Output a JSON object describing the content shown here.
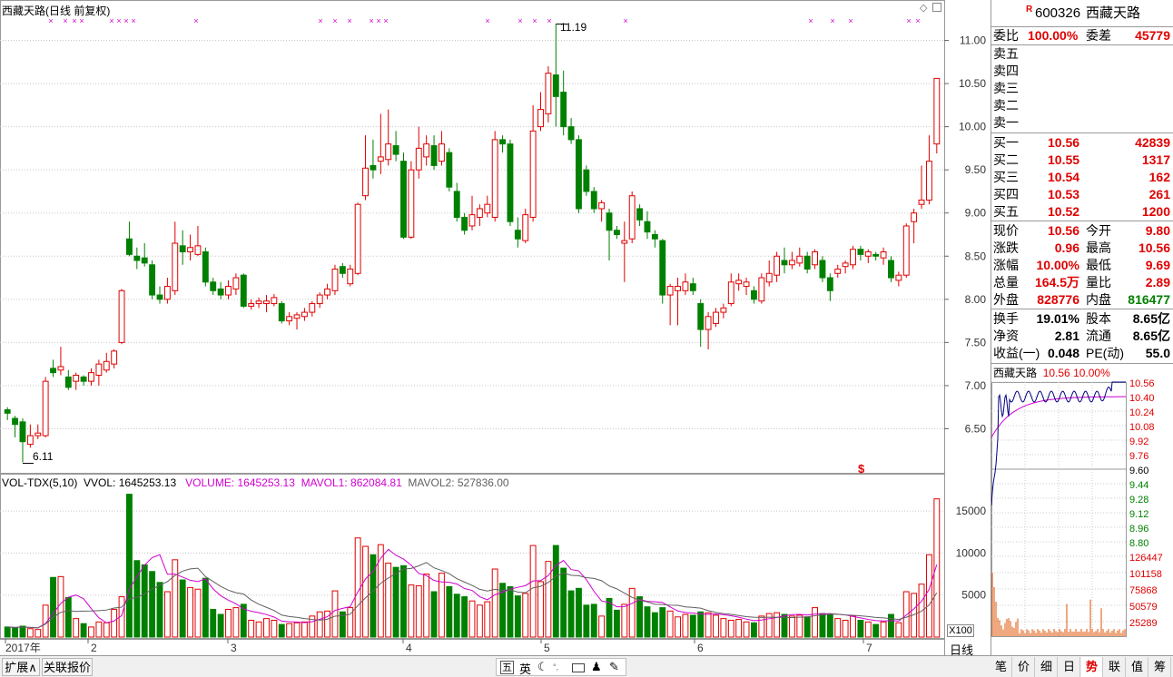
{
  "main_chart": {
    "title": "西藏天路(日线 前复权)",
    "high_marker": "11.19",
    "low_marker": "6.11",
    "signal_mark": "$",
    "price_ticks": [
      "11.00",
      "10.50",
      "10.00",
      "9.50",
      "9.00",
      "8.50",
      "8.00",
      "7.50",
      "7.00",
      "6.50"
    ],
    "date_labels": [
      "2017年",
      "2",
      "3",
      "4",
      "5",
      "6",
      "7"
    ],
    "colors": {
      "up": "#e00000",
      "down": "#008000",
      "grid": "#c8c8c8",
      "ma1": "#d000d0",
      "ma2": "#606060"
    }
  },
  "volume_panel": {
    "indicator": "VOL-TDX(5,10)",
    "vvol": "VVOL: 1645253.13",
    "volume": "VOLUME: 1645253.13",
    "mavol1": "MAVOL1: 862084.81",
    "mavol2": "MAVOL2: 527836.00",
    "ticks": [
      "15000",
      "10000",
      "5000"
    ],
    "unit_label": "X100",
    "period_label": "日线"
  },
  "chart_data": {
    "type": "candlestick",
    "title": "西藏天路(日线 前复权)",
    "ylim": [
      6.0,
      11.3
    ],
    "candles": [
      {
        "o": 6.72,
        "c": 6.68,
        "h": 6.75,
        "l": 6.6,
        "v": 1200
      },
      {
        "o": 6.62,
        "c": 6.55,
        "h": 6.65,
        "l": 6.4,
        "v": 1100
      },
      {
        "o": 6.58,
        "c": 6.35,
        "h": 6.62,
        "l": 6.11,
        "v": 1300
      },
      {
        "o": 6.32,
        "c": 6.42,
        "h": 6.55,
        "l": 6.28,
        "v": 1000
      },
      {
        "o": 6.42,
        "c": 6.45,
        "h": 6.55,
        "l": 6.38,
        "v": 900
      },
      {
        "o": 6.42,
        "c": 7.05,
        "h": 7.1,
        "l": 6.4,
        "v": 3800
      },
      {
        "o": 7.2,
        "c": 7.15,
        "h": 7.3,
        "l": 7.1,
        "v": 7100
      },
      {
        "o": 7.18,
        "c": 7.22,
        "h": 7.45,
        "l": 7.12,
        "v": 7200
      },
      {
        "o": 7.1,
        "c": 6.98,
        "h": 7.18,
        "l": 6.95,
        "v": 4700
      },
      {
        "o": 7.05,
        "c": 7.12,
        "h": 7.15,
        "l": 6.95,
        "v": 2200
      },
      {
        "o": 7.1,
        "c": 7.05,
        "h": 7.12,
        "l": 7.0,
        "v": 1600
      },
      {
        "o": 7.05,
        "c": 7.15,
        "h": 7.2,
        "l": 7.0,
        "v": 1200
      },
      {
        "o": 7.12,
        "c": 7.25,
        "h": 7.3,
        "l": 7.0,
        "v": 1800
      },
      {
        "o": 7.18,
        "c": 7.28,
        "h": 7.38,
        "l": 7.15,
        "v": 1700
      },
      {
        "o": 7.25,
        "c": 7.4,
        "h": 7.42,
        "l": 7.2,
        "v": 3300
      },
      {
        "o": 7.5,
        "c": 8.1,
        "h": 8.12,
        "l": 7.48,
        "v": 4800
      },
      {
        "o": 8.7,
        "c": 8.52,
        "h": 8.9,
        "l": 8.5,
        "v": 17000
      },
      {
        "o": 8.5,
        "c": 8.45,
        "h": 8.6,
        "l": 8.35,
        "v": 9100
      },
      {
        "o": 8.48,
        "c": 8.42,
        "h": 8.65,
        "l": 8.38,
        "v": 8600
      },
      {
        "o": 8.4,
        "c": 8.05,
        "h": 8.45,
        "l": 8.0,
        "v": 7800
      },
      {
        "o": 8.05,
        "c": 8.0,
        "h": 8.15,
        "l": 7.95,
        "v": 6500
      },
      {
        "o": 8.0,
        "c": 8.15,
        "h": 8.25,
        "l": 7.95,
        "v": 5400
      },
      {
        "o": 8.1,
        "c": 8.65,
        "h": 8.9,
        "l": 8.05,
        "v": 9200
      },
      {
        "o": 8.62,
        "c": 8.55,
        "h": 8.8,
        "l": 8.4,
        "v": 6800
      },
      {
        "o": 8.55,
        "c": 8.6,
        "h": 8.75,
        "l": 8.45,
        "v": 5900
      },
      {
        "o": 8.52,
        "c": 8.62,
        "h": 8.85,
        "l": 8.5,
        "v": 5700
      },
      {
        "o": 8.55,
        "c": 8.2,
        "h": 8.6,
        "l": 8.15,
        "v": 7000
      },
      {
        "o": 8.2,
        "c": 8.1,
        "h": 8.25,
        "l": 8.05,
        "v": 3300
      },
      {
        "o": 8.12,
        "c": 8.05,
        "h": 8.2,
        "l": 8.0,
        "v": 2700
      },
      {
        "o": 8.05,
        "c": 8.15,
        "h": 8.22,
        "l": 8.0,
        "v": 3300
      },
      {
        "o": 8.12,
        "c": 8.25,
        "h": 8.3,
        "l": 8.05,
        "v": 3500
      },
      {
        "o": 8.28,
        "c": 7.92,
        "h": 8.3,
        "l": 7.9,
        "v": 3900
      },
      {
        "o": 7.92,
        "c": 7.95,
        "h": 8.0,
        "l": 7.88,
        "v": 2000
      },
      {
        "o": 7.95,
        "c": 7.98,
        "h": 8.02,
        "l": 7.9,
        "v": 1800
      },
      {
        "o": 7.95,
        "c": 7.98,
        "h": 8.05,
        "l": 7.85,
        "v": 2200
      },
      {
        "o": 7.95,
        "c": 8.02,
        "h": 8.06,
        "l": 7.92,
        "v": 2000
      },
      {
        "o": 7.95,
        "c": 7.75,
        "h": 7.98,
        "l": 7.72,
        "v": 1500
      },
      {
        "o": 7.75,
        "c": 7.8,
        "h": 7.85,
        "l": 7.7,
        "v": 1600
      },
      {
        "o": 7.78,
        "c": 7.82,
        "h": 7.85,
        "l": 7.65,
        "v": 1700
      },
      {
        "o": 7.8,
        "c": 7.85,
        "h": 7.9,
        "l": 7.75,
        "v": 1800
      },
      {
        "o": 7.85,
        "c": 7.95,
        "h": 7.98,
        "l": 7.8,
        "v": 2500
      },
      {
        "o": 7.95,
        "c": 8.05,
        "h": 8.08,
        "l": 7.9,
        "v": 3000
      },
      {
        "o": 8.05,
        "c": 8.12,
        "h": 8.18,
        "l": 8.0,
        "v": 3100
      },
      {
        "o": 8.1,
        "c": 8.35,
        "h": 8.4,
        "l": 8.05,
        "v": 5500
      },
      {
        "o": 8.38,
        "c": 8.3,
        "h": 8.42,
        "l": 8.25,
        "v": 3000
      },
      {
        "o": 8.18,
        "c": 8.35,
        "h": 8.4,
        "l": 8.15,
        "v": 3500
      },
      {
        "o": 8.3,
        "c": 9.1,
        "h": 9.12,
        "l": 8.28,
        "v": 11800
      },
      {
        "o": 9.2,
        "c": 9.52,
        "h": 9.9,
        "l": 9.15,
        "v": 10800
      },
      {
        "o": 9.55,
        "c": 9.5,
        "h": 9.85,
        "l": 9.4,
        "v": 9800
      },
      {
        "o": 9.6,
        "c": 9.65,
        "h": 10.15,
        "l": 9.45,
        "v": 11000
      },
      {
        "o": 9.62,
        "c": 9.8,
        "h": 10.2,
        "l": 9.55,
        "v": 8800
      },
      {
        "o": 9.78,
        "c": 9.68,
        "h": 9.95,
        "l": 9.6,
        "v": 8300
      },
      {
        "o": 9.6,
        "c": 8.72,
        "h": 9.7,
        "l": 8.7,
        "v": 8500
      },
      {
        "o": 8.72,
        "c": 9.5,
        "h": 9.6,
        "l": 8.7,
        "v": 6200
      },
      {
        "o": 9.5,
        "c": 9.75,
        "h": 10.0,
        "l": 9.4,
        "v": 6100
      },
      {
        "o": 9.65,
        "c": 9.8,
        "h": 9.9,
        "l": 9.55,
        "v": 7500
      },
      {
        "o": 9.78,
        "c": 9.55,
        "h": 9.9,
        "l": 9.5,
        "v": 5400
      },
      {
        "o": 9.6,
        "c": 9.8,
        "h": 9.95,
        "l": 9.55,
        "v": 7600
      },
      {
        "o": 9.7,
        "c": 9.3,
        "h": 9.75,
        "l": 9.25,
        "v": 6000
      },
      {
        "o": 9.25,
        "c": 8.95,
        "h": 9.35,
        "l": 8.9,
        "v": 5100
      },
      {
        "o": 8.95,
        "c": 8.8,
        "h": 9.0,
        "l": 8.75,
        "v": 4800
      },
      {
        "o": 8.85,
        "c": 8.98,
        "h": 9.2,
        "l": 8.8,
        "v": 4300
      },
      {
        "o": 8.95,
        "c": 9.05,
        "h": 9.1,
        "l": 8.85,
        "v": 3800
      },
      {
        "o": 9.0,
        "c": 9.1,
        "h": 9.2,
        "l": 8.95,
        "v": 4200
      },
      {
        "o": 8.95,
        "c": 9.85,
        "h": 9.95,
        "l": 8.9,
        "v": 8100
      },
      {
        "o": 9.85,
        "c": 9.8,
        "h": 9.9,
        "l": 9.7,
        "v": 6400
      },
      {
        "o": 9.8,
        "c": 8.9,
        "h": 9.85,
        "l": 8.85,
        "v": 6000
      },
      {
        "o": 8.8,
        "c": 8.7,
        "h": 8.95,
        "l": 8.6,
        "v": 4900
      },
      {
        "o": 8.68,
        "c": 8.98,
        "h": 9.05,
        "l": 8.65,
        "v": 5200
      },
      {
        "o": 8.95,
        "c": 9.95,
        "h": 10.25,
        "l": 8.9,
        "v": 10900
      },
      {
        "o": 10.0,
        "c": 10.2,
        "h": 10.4,
        "l": 9.95,
        "v": 6600
      },
      {
        "o": 10.15,
        "c": 10.62,
        "h": 10.7,
        "l": 10.05,
        "v": 9000
      },
      {
        "o": 10.6,
        "c": 10.35,
        "h": 11.19,
        "l": 10.0,
        "v": 10900
      },
      {
        "o": 10.4,
        "c": 10.0,
        "h": 10.65,
        "l": 9.9,
        "v": 8200
      },
      {
        "o": 10.0,
        "c": 9.85,
        "h": 10.1,
        "l": 9.8,
        "v": 5500
      },
      {
        "o": 9.85,
        "c": 9.05,
        "h": 9.9,
        "l": 9.0,
        "v": 5800
      },
      {
        "o": 9.5,
        "c": 9.25,
        "h": 9.55,
        "l": 9.2,
        "v": 3800
      },
      {
        "o": 9.25,
        "c": 9.05,
        "h": 9.3,
        "l": 9.0,
        "v": 3900
      },
      {
        "o": 9.05,
        "c": 9.12,
        "h": 9.15,
        "l": 8.9,
        "v": 2500
      },
      {
        "o": 9.0,
        "c": 8.8,
        "h": 9.05,
        "l": 8.45,
        "v": 4600
      },
      {
        "o": 8.8,
        "c": 8.75,
        "h": 8.85,
        "l": 8.7,
        "v": 3200
      },
      {
        "o": 8.65,
        "c": 8.68,
        "h": 8.9,
        "l": 8.2,
        "v": 3900
      },
      {
        "o": 8.7,
        "c": 9.2,
        "h": 9.25,
        "l": 8.65,
        "v": 5800
      },
      {
        "o": 9.05,
        "c": 8.92,
        "h": 9.1,
        "l": 8.85,
        "v": 4800
      },
      {
        "o": 8.9,
        "c": 8.78,
        "h": 9.02,
        "l": 8.7,
        "v": 3600
      },
      {
        "o": 8.75,
        "c": 8.7,
        "h": 8.8,
        "l": 8.6,
        "v": 2900
      },
      {
        "o": 8.68,
        "c": 8.05,
        "h": 8.7,
        "l": 7.95,
        "v": 3500
      },
      {
        "o": 8.05,
        "c": 8.15,
        "h": 8.18,
        "l": 7.7,
        "v": 3100
      },
      {
        "o": 8.1,
        "c": 8.15,
        "h": 8.25,
        "l": 7.7,
        "v": 2400
      },
      {
        "o": 8.1,
        "c": 8.2,
        "h": 8.3,
        "l": 8.05,
        "v": 2700
      },
      {
        "o": 8.18,
        "c": 8.1,
        "h": 8.25,
        "l": 8.05,
        "v": 2600
      },
      {
        "o": 7.95,
        "c": 7.65,
        "h": 8.0,
        "l": 7.45,
        "v": 3000
      },
      {
        "o": 7.65,
        "c": 7.8,
        "h": 7.85,
        "l": 7.42,
        "v": 2900
      },
      {
        "o": 7.72,
        "c": 7.85,
        "h": 7.9,
        "l": 7.68,
        "v": 2600
      },
      {
        "o": 7.85,
        "c": 7.9,
        "h": 7.95,
        "l": 7.78,
        "v": 2200
      },
      {
        "o": 7.95,
        "c": 8.2,
        "h": 8.3,
        "l": 7.92,
        "v": 2000
      },
      {
        "o": 8.18,
        "c": 8.22,
        "h": 8.3,
        "l": 8.1,
        "v": 2100
      },
      {
        "o": 8.15,
        "c": 8.2,
        "h": 8.25,
        "l": 8.05,
        "v": 1800
      },
      {
        "o": 8.1,
        "c": 8.0,
        "h": 8.15,
        "l": 7.95,
        "v": 1700
      },
      {
        "o": 7.98,
        "c": 8.25,
        "h": 8.3,
        "l": 7.95,
        "v": 2500
      },
      {
        "o": 8.2,
        "c": 8.3,
        "h": 8.45,
        "l": 8.15,
        "v": 2800
      },
      {
        "o": 8.28,
        "c": 8.5,
        "h": 8.55,
        "l": 8.2,
        "v": 2900
      },
      {
        "o": 8.45,
        "c": 8.4,
        "h": 8.6,
        "l": 8.3,
        "v": 2700
      },
      {
        "o": 8.4,
        "c": 8.45,
        "h": 8.55,
        "l": 8.35,
        "v": 2500
      },
      {
        "o": 8.42,
        "c": 8.5,
        "h": 8.6,
        "l": 8.38,
        "v": 2600
      },
      {
        "o": 8.5,
        "c": 8.35,
        "h": 8.55,
        "l": 8.3,
        "v": 2400
      },
      {
        "o": 8.4,
        "c": 8.55,
        "h": 8.58,
        "l": 8.35,
        "v": 3500
      },
      {
        "o": 8.45,
        "c": 8.25,
        "h": 8.5,
        "l": 8.2,
        "v": 2800
      },
      {
        "o": 8.25,
        "c": 8.1,
        "h": 8.3,
        "l": 7.98,
        "v": 2700
      },
      {
        "o": 8.3,
        "c": 8.35,
        "h": 8.4,
        "l": 8.25,
        "v": 2200
      },
      {
        "o": 8.38,
        "c": 8.42,
        "h": 8.45,
        "l": 8.3,
        "v": 2000
      },
      {
        "o": 8.4,
        "c": 8.58,
        "h": 8.62,
        "l": 8.35,
        "v": 2500
      },
      {
        "o": 8.58,
        "c": 8.52,
        "h": 8.62,
        "l": 8.45,
        "v": 2000
      },
      {
        "o": 8.5,
        "c": 8.55,
        "h": 8.58,
        "l": 8.42,
        "v": 1800
      },
      {
        "o": 8.52,
        "c": 8.5,
        "h": 8.55,
        "l": 8.45,
        "v": 1500
      },
      {
        "o": 8.48,
        "c": 8.55,
        "h": 8.6,
        "l": 8.4,
        "v": 1800
      },
      {
        "o": 8.45,
        "c": 8.25,
        "h": 8.5,
        "l": 8.2,
        "v": 2700
      },
      {
        "o": 8.22,
        "c": 8.28,
        "h": 8.32,
        "l": 8.15,
        "v": 1700
      },
      {
        "o": 8.28,
        "c": 8.85,
        "h": 8.88,
        "l": 8.25,
        "v": 5400
      },
      {
        "o": 8.9,
        "c": 9.0,
        "h": 9.05,
        "l": 8.65,
        "v": 5200
      },
      {
        "o": 9.1,
        "c": 9.15,
        "h": 9.55,
        "l": 9.05,
        "v": 6300
      },
      {
        "o": 9.15,
        "c": 9.6,
        "h": 9.9,
        "l": 9.1,
        "v": 9800
      },
      {
        "o": 9.8,
        "c": 10.56,
        "h": 10.56,
        "l": 9.69,
        "v": 16452
      }
    ],
    "ma_vol": {
      "mavol1_last": 862084.81,
      "mavol2_last": 527836.0
    },
    "xlabels": [
      "2017年",
      "2",
      "3",
      "4",
      "5",
      "6",
      "7"
    ],
    "yticks": [
      11.0,
      10.5,
      10.0,
      9.5,
      9.0,
      8.5,
      8.0,
      7.5,
      7.0,
      6.5
    ]
  },
  "quote_panel": {
    "r_badge": "R",
    "code": "600326",
    "name": "西藏天路",
    "weibi_label": "委比",
    "weibi_value": "100.00%",
    "weicha_label": "委差",
    "weicha_value": "45779",
    "sells": [
      {
        "label": "卖五",
        "price": "",
        "vol": ""
      },
      {
        "label": "卖四",
        "price": "",
        "vol": ""
      },
      {
        "label": "卖三",
        "price": "",
        "vol": ""
      },
      {
        "label": "卖二",
        "price": "",
        "vol": ""
      },
      {
        "label": "卖一",
        "price": "",
        "vol": ""
      }
    ],
    "buys": [
      {
        "label": "买一",
        "price": "10.56",
        "vol": "42839"
      },
      {
        "label": "买二",
        "price": "10.55",
        "vol": "1317"
      },
      {
        "label": "买三",
        "price": "10.54",
        "vol": "162"
      },
      {
        "label": "买四",
        "price": "10.53",
        "vol": "261"
      },
      {
        "label": "买五",
        "price": "10.52",
        "vol": "1200"
      }
    ],
    "stats": [
      {
        "l1": "现价",
        "v1": "10.56",
        "l2": "今开",
        "v2": "9.80",
        "c1": "red",
        "c2": "red"
      },
      {
        "l1": "涨跌",
        "v1": "0.96",
        "l2": "最高",
        "v2": "10.56",
        "c1": "red",
        "c2": "red"
      },
      {
        "l1": "涨幅",
        "v1": "10.00%",
        "l2": "最低",
        "v2": "9.69",
        "c1": "red",
        "c2": "red"
      },
      {
        "l1": "总量",
        "v1": "164.5万",
        "l2": "量比",
        "v2": "2.89",
        "c1": "red",
        "c2": "red"
      },
      {
        "l1": "外盘",
        "v1": "828776",
        "l2": "内盘",
        "v2": "816477",
        "c1": "red",
        "c2": "grn"
      }
    ],
    "fundamentals": [
      {
        "l1": "换手",
        "v1": "19.01%",
        "l2": "股本",
        "v2": "8.65亿"
      },
      {
        "l1": "净资",
        "v1": "2.81",
        "l2": "流通",
        "v2": "8.65亿"
      },
      {
        "l1": "收益(一)",
        "v1": "0.048",
        "l2": "PE(动)",
        "v2": "55.0"
      }
    ]
  },
  "mini_chart": {
    "name": "西藏天路",
    "price": "10.56",
    "pct": "10.00%",
    "price_ticks_up": [
      "10.56",
      "10.40",
      "10.24",
      "10.08",
      "9.92",
      "9.76"
    ],
    "price_mid": "9.60",
    "price_ticks_down": [
      "9.44",
      "9.28",
      "9.12",
      "8.96",
      "8.80"
    ],
    "vol_ticks": [
      "126447",
      "101158",
      "75868",
      "50579",
      "25289"
    ]
  },
  "tabs": [
    "笔",
    "价",
    "细",
    "日",
    "势",
    "联",
    "值",
    "筹"
  ],
  "active_tab": "势",
  "bottom": {
    "expand_label": "扩展∧",
    "related_label": "关联报价",
    "ime_wu": "五",
    "ime_en": "英"
  }
}
